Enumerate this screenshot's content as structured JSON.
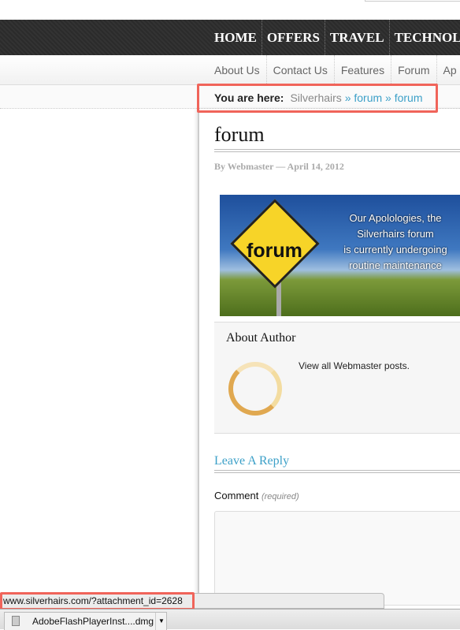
{
  "nav": {
    "primary": [
      "HOME",
      "OFFERS",
      "TRAVEL",
      "TECHNOLOGY"
    ],
    "secondary": [
      "About Us",
      "Contact Us",
      "Features",
      "Forum",
      "Ap"
    ]
  },
  "breadcrumb": {
    "label": "You are here:",
    "home": "Silverhairs",
    "path": "» forum » forum"
  },
  "post": {
    "title": "forum",
    "byline": "By Webmaster — April 14, 2012",
    "banner": {
      "sign_text": "forum",
      "lines": [
        "Our Apolologies, the",
        "Silverhairs forum",
        "is currently undergoing",
        "routine maintenance"
      ]
    }
  },
  "author": {
    "heading": "About Author",
    "link": "View all Webmaster posts."
  },
  "reply": {
    "heading": "Leave A Reply",
    "comment_label": "Comment",
    "required": "(required)"
  },
  "statusbar": {
    "url": "www.silverhairs.com/?attachment_id=2628"
  },
  "downloads": {
    "file": "AdobeFlashPlayerInst....dmg"
  },
  "colors": {
    "highlight": "#f0645a",
    "link": "#3ca0c8",
    "nav_bg": "#2e2e2e"
  }
}
